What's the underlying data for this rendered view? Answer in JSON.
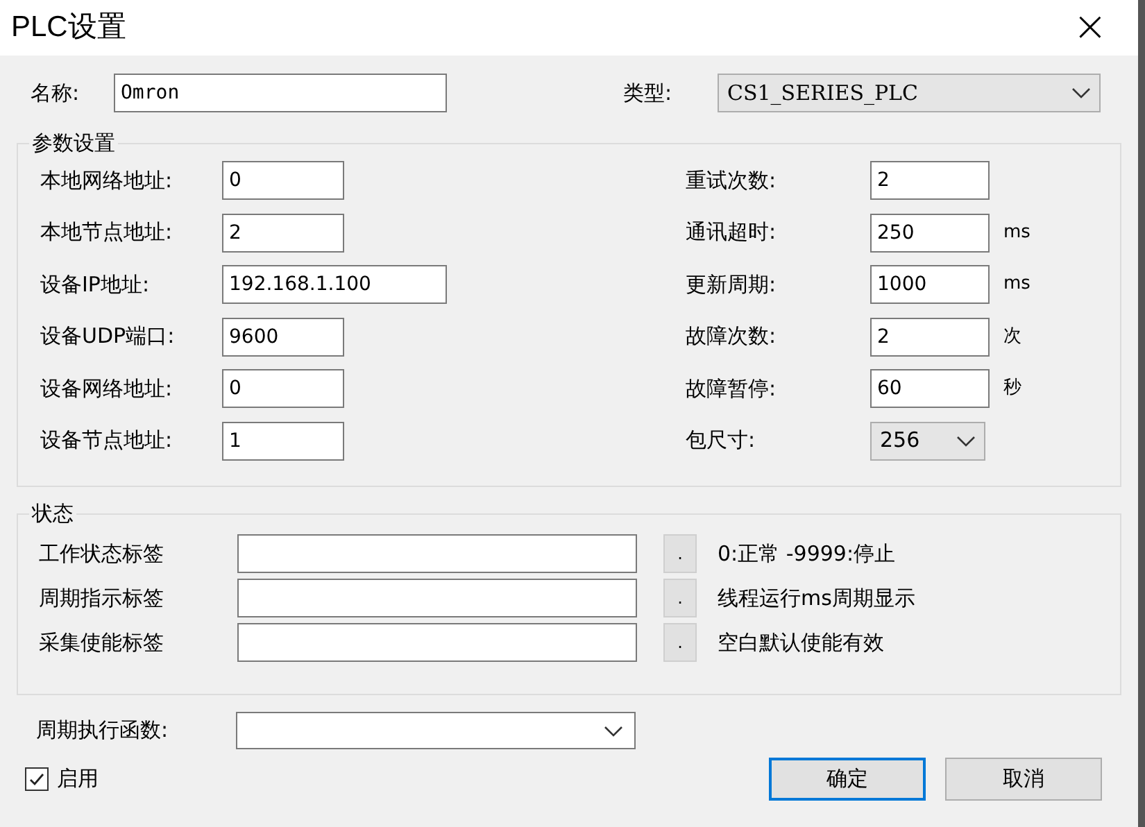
{
  "window": {
    "title": "PLC设置",
    "close": "×"
  },
  "name": {
    "label": "名称:",
    "value": "Omron"
  },
  "type": {
    "label": "类型:",
    "value": "CS1_SERIES_PLC"
  },
  "params": {
    "title": "参数设置",
    "left": [
      {
        "label": "本地网络地址:",
        "value": "0",
        "wide": false
      },
      {
        "label": "本地节点地址:",
        "value": "2",
        "wide": false
      },
      {
        "label": "设备IP地址:",
        "value": "192.168.1.100",
        "wide": true
      },
      {
        "label": "设备UDP端口:",
        "value": "9600",
        "wide": false
      },
      {
        "label": "设备网络地址:",
        "value": "0",
        "wide": false
      },
      {
        "label": "设备节点地址:",
        "value": "1",
        "wide": false
      }
    ],
    "right": [
      {
        "kind": "input",
        "label": "重试次数:",
        "value": "2"
      },
      {
        "kind": "input",
        "label": "通讯超时:",
        "value": "250",
        "unit": "ms"
      },
      {
        "kind": "input",
        "label": "更新周期:",
        "value": "1000",
        "unit": "ms"
      },
      {
        "kind": "input",
        "label": "故障次数:",
        "value": "2",
        "unit": "次"
      },
      {
        "kind": "input",
        "label": "故障暂停:",
        "value": "60",
        "unit": "秒"
      },
      {
        "kind": "select",
        "label": "包尺寸:",
        "value": "256"
      }
    ]
  },
  "status": {
    "title": "状态",
    "rows": [
      {
        "label": "工作状态标签",
        "button": ".",
        "hint": "0:正常 -9999:停止"
      },
      {
        "label": "周期指示标签",
        "button": ".",
        "hint": "线程运行ms周期显示"
      },
      {
        "label": "采集使能标签",
        "button": ".",
        "hint": "空白默认使能有效"
      }
    ]
  },
  "function": {
    "label": "周期执行函数:"
  },
  "enable": {
    "label": "启用",
    "checked": true
  },
  "buttons": [
    {
      "label": "确定",
      "default": true
    },
    {
      "label": "取消",
      "default": false
    }
  ]
}
